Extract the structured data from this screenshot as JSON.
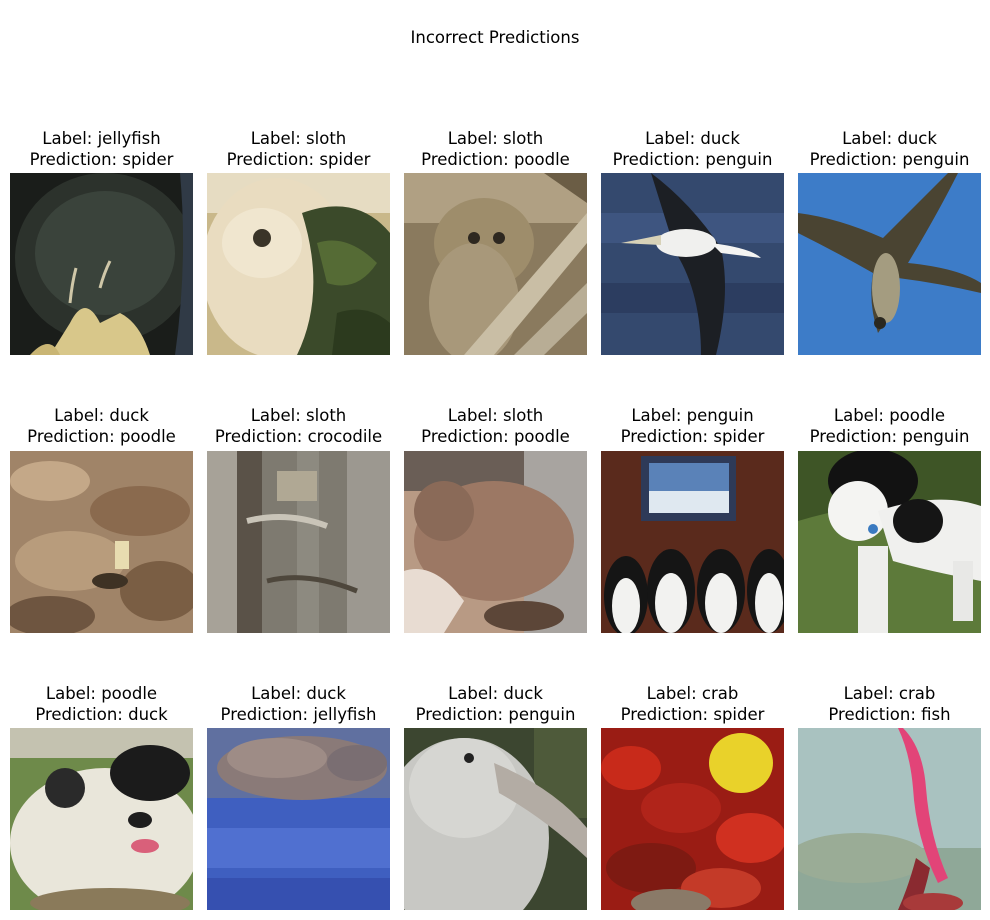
{
  "figure": {
    "title": "Incorrect Predictions"
  },
  "panels": [
    {
      "label": "Label: jellyfish",
      "prediction": "Prediction: spider",
      "image": "dark-jellyfish-photo"
    },
    {
      "label": "Label: sloth",
      "prediction": "Prediction: spider",
      "image": "white-furry-animal-photo"
    },
    {
      "label": "Label: sloth",
      "prediction": "Prediction: poodle",
      "image": "koala-on-branch-photo"
    },
    {
      "label": "Label: duck",
      "prediction": "Prediction: penguin",
      "image": "albatross-over-water-photo"
    },
    {
      "label": "Label: duck",
      "prediction": "Prediction: penguin",
      "image": "bird-in-flight-blue-sky-photo"
    },
    {
      "label": "Label: duck",
      "prediction": "Prediction: poodle",
      "image": "rocky-ground-photo"
    },
    {
      "label": "Label: sloth",
      "prediction": "Prediction: crocodile",
      "image": "forest-tree-trunk-photo"
    },
    {
      "label": "Label: sloth",
      "prediction": "Prediction: poodle",
      "image": "furry-brown-animal-photo"
    },
    {
      "label": "Label: penguin",
      "prediction": "Prediction: spider",
      "image": "penguins-watching-screen-photo"
    },
    {
      "label": "Label: poodle",
      "prediction": "Prediction: penguin",
      "image": "black-white-dog-photo"
    },
    {
      "label": "Label: poodle",
      "prediction": "Prediction: duck",
      "image": "fluffy-dog-on-grass-photo"
    },
    {
      "label": "Label: duck",
      "prediction": "Prediction: jellyfish",
      "image": "duck-on-blue-water-photo"
    },
    {
      "label": "Label: duck",
      "prediction": "Prediction: penguin",
      "image": "white-seabird-closeup-photo"
    },
    {
      "label": "Label: crab",
      "prediction": "Prediction: spider",
      "image": "red-crabs-pile-photo"
    },
    {
      "label": "Label: crab",
      "prediction": "Prediction: fish",
      "image": "pink-coral-underwater-photo"
    }
  ]
}
